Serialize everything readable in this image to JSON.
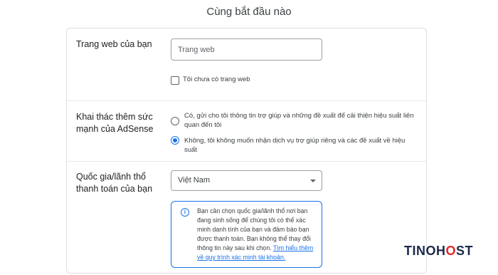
{
  "page_title": "Cùng bắt đầu nào",
  "website": {
    "label": "Trang web của bạn",
    "input_placeholder": "Trang web",
    "input_value": "",
    "no_website_label": "Tôi chưa có trang web"
  },
  "adsense": {
    "label": "Khai thác thêm sức mạnh của AdSense",
    "option_yes": "Có, gửi cho tôi thông tin trợ giúp và những đề xuất để cải thiện hiệu suất liên quan đến tôi",
    "option_no": "Không, tôi không muốn nhận dịch vụ trợ giúp riêng và các đề xuất về hiệu suất",
    "selected": "no"
  },
  "country": {
    "label": "Quốc gia/lãnh thổ thanh toán của bạn",
    "selected_value": "Việt Nam",
    "info_text": "Bạn cần chọn quốc gia/lãnh thổ nơi bạn đang sinh sống để chúng tôi có thể xác minh danh tính của bạn và đảm bảo bạn được thanh toán. Bạn không thể thay đổi thông tin này sau khi chọn.",
    "info_link": "Tìm hiểu thêm về quy trình xác minh tài khoản."
  },
  "brand": {
    "part1": "TINO",
    "part2": "H",
    "part3": "O",
    "part4": "ST"
  },
  "colors": {
    "accent": "#1a73e8",
    "brand_red": "#e5262a",
    "brand_navy": "#1b2a4a"
  }
}
